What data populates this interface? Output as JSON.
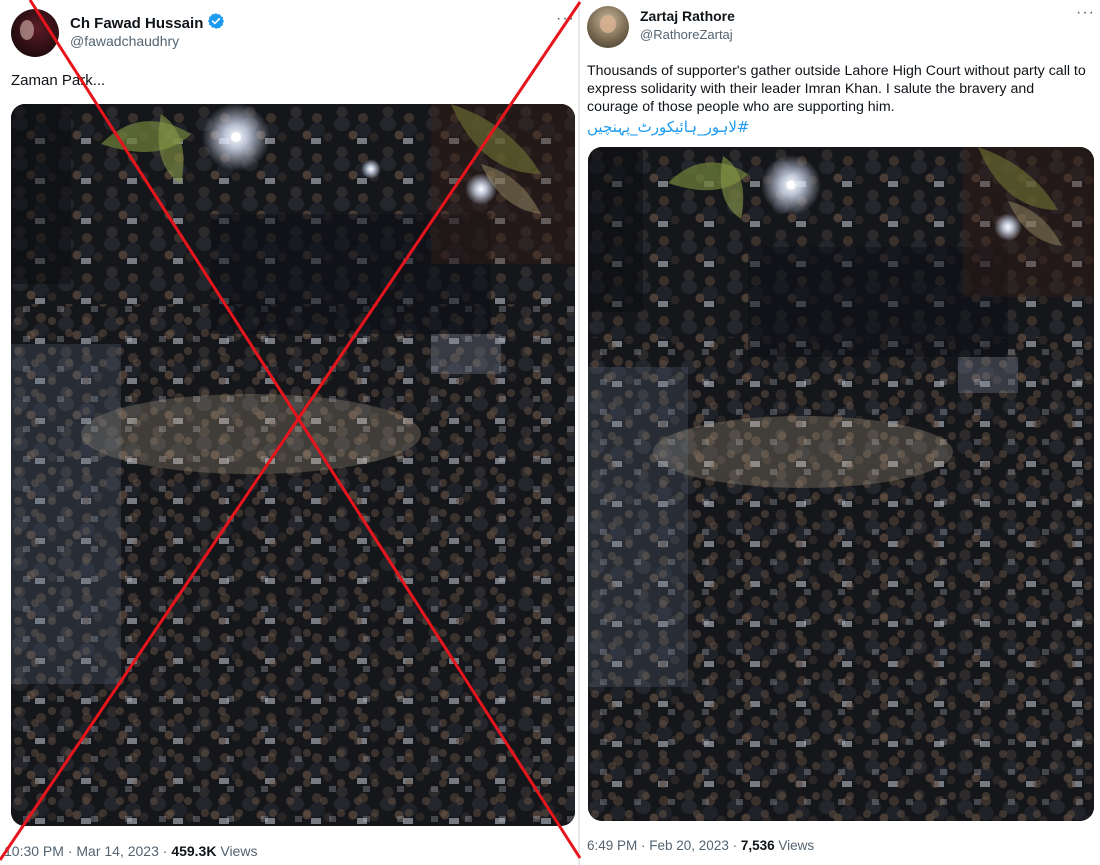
{
  "left_tweet": {
    "display_name": "Ch Fawad Hussain",
    "handle": "@fawadchaudhry",
    "text": "Zaman Park...",
    "time_date": "10:30 PM · Mar 14, 2023 · ",
    "views_count": "459.3K",
    "views_label": " Views",
    "more_icon": "more-icon",
    "verified_icon": "verified-badge-icon",
    "verified_color": "#1d9bf0"
  },
  "right_tweet": {
    "display_name": "Zartaj Rathore",
    "handle": "@RathoreZartaj",
    "text": "Thousands of supporter's gather outside Lahore High Court without party call to express solidarity with their leader Imran Khan. I salute the bravery and courage of those people who are supporting him.",
    "hashtag": "#لاہور_ہائیکورٹ_پہنچیں",
    "time_date": "6:49 PM · Feb 20, 2023 · ",
    "views_count": "7,536",
    "views_label": " Views",
    "more_icon": "more-icon"
  },
  "overlay": {
    "icon": "red-cross-mark",
    "color": "#e8141c"
  },
  "colors": {
    "text": "#0f1419",
    "secondary": "#536471",
    "link": "#1d9bf0"
  }
}
